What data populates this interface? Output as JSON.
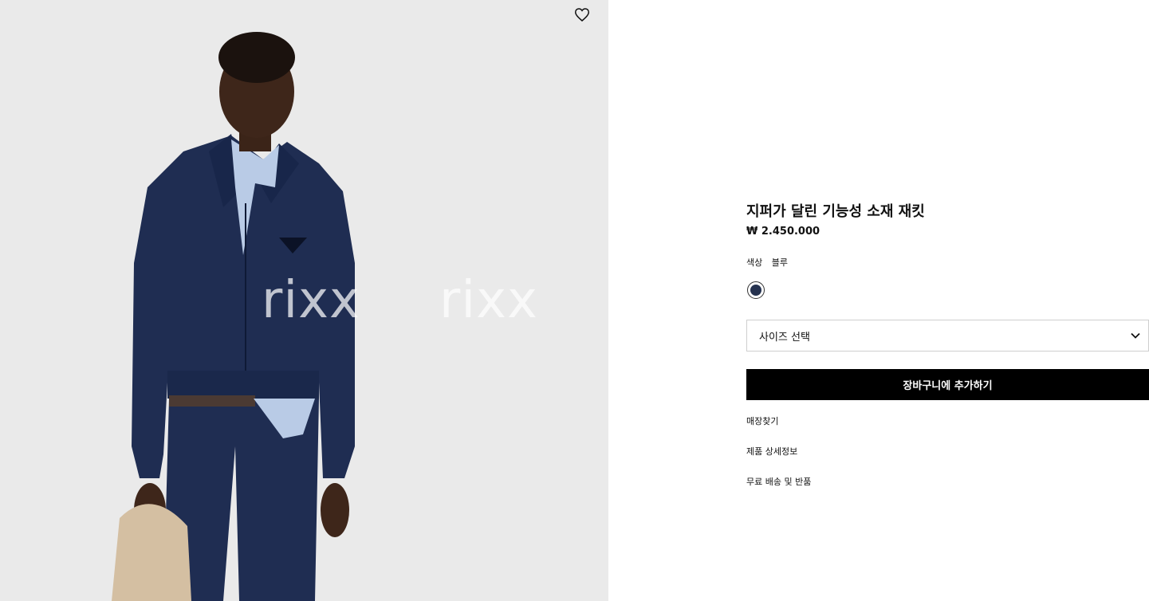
{
  "product": {
    "title": "지퍼가 달린 기능성 소재 재킷",
    "price": "₩ 2.450.000",
    "color_label": "색상",
    "color_value": "블루",
    "swatch_color": "#25324f",
    "size_placeholder": "사이즈 선택",
    "add_to_cart_label": "장바구니에 추가하기"
  },
  "links": {
    "store_finder": "매장찾기",
    "product_details": "제품 상세정보",
    "shipping_returns": "무료 배송 및 반품"
  },
  "image": {
    "watermark_1": "rixx",
    "watermark_2": "rixx",
    "jacket_color": "#1f2d52",
    "background": "#e9e9e9"
  },
  "icons": {
    "wishlist": "heart-icon",
    "size_dropdown": "chevron-down-icon"
  }
}
